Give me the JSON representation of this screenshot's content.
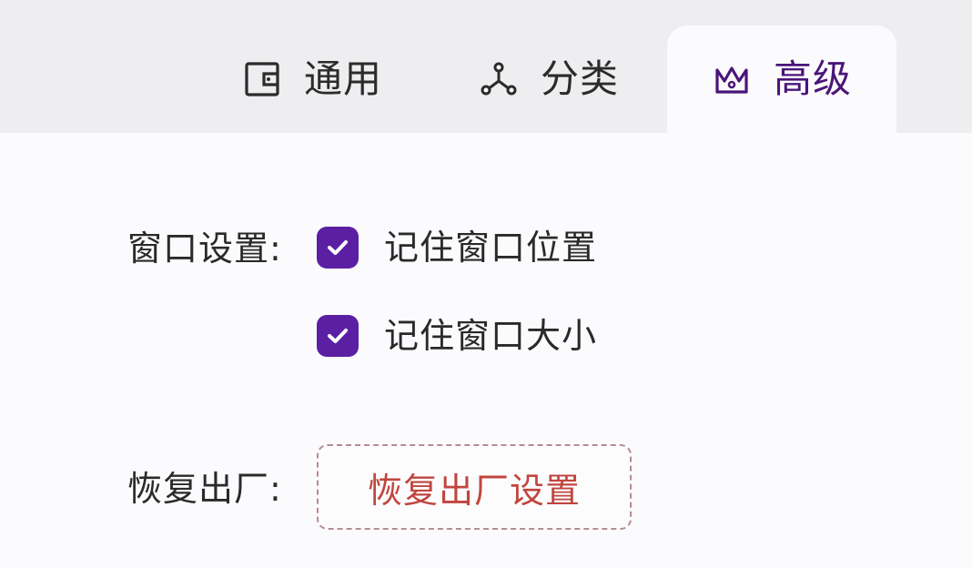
{
  "tabs": {
    "general": {
      "label": "通用",
      "icon": "wallet-icon"
    },
    "category": {
      "label": "分类",
      "icon": "nodes-icon"
    },
    "advanced": {
      "label": "高级",
      "icon": "crown-icon",
      "active": true
    }
  },
  "window_settings": {
    "label": "窗口设置:",
    "options": [
      {
        "label": "记住窗口位置",
        "checked": true
      },
      {
        "label": "记住窗口大小",
        "checked": true
      }
    ]
  },
  "factory_reset": {
    "label": "恢复出厂:",
    "button_label": "恢复出厂设置"
  },
  "colors": {
    "accent": "#5b1fa3",
    "danger_text": "#c0463f",
    "tabbar_bg": "#eeedef",
    "content_bg": "#fbfafd"
  }
}
